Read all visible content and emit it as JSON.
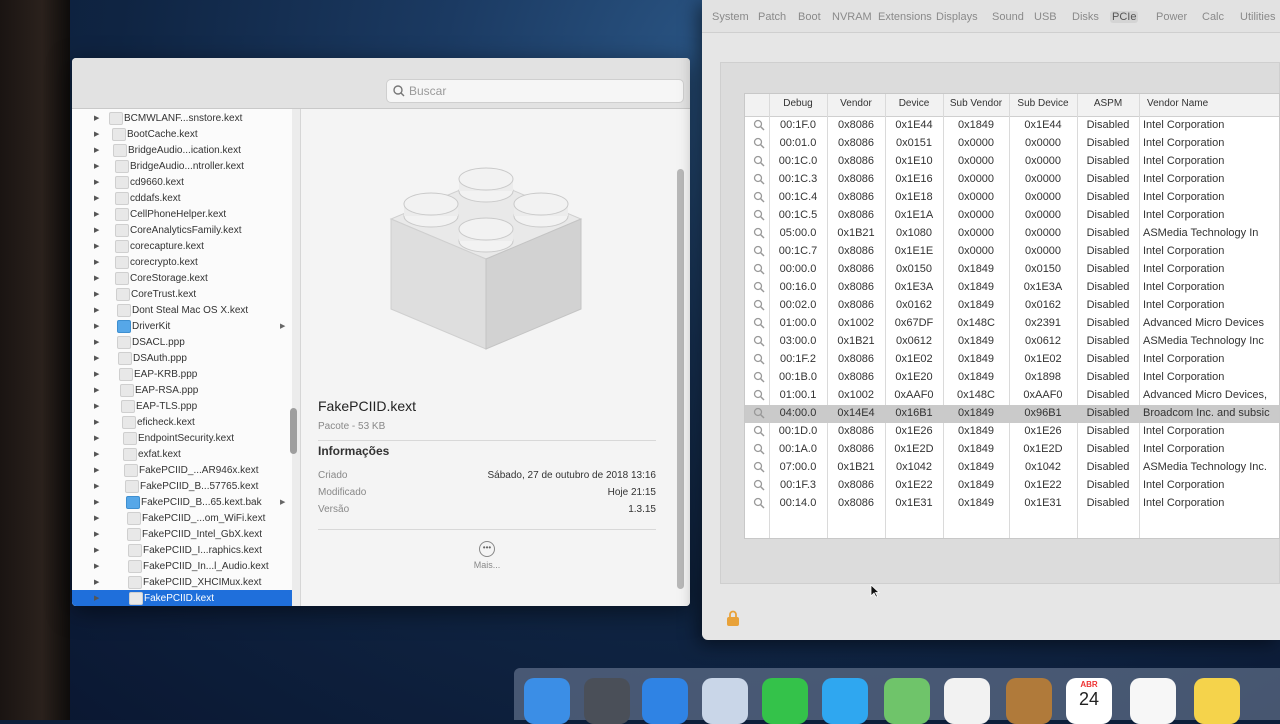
{
  "finder": {
    "search_placeholder": "Buscar",
    "files": [
      {
        "name": "BCMWLANF...snstore.kext"
      },
      {
        "name": "BootCache.kext"
      },
      {
        "name": "BridgeAudio...ication.kext"
      },
      {
        "name": "BridgeAudio...ntroller.kext"
      },
      {
        "name": "cd9660.kext"
      },
      {
        "name": "cddafs.kext"
      },
      {
        "name": "CellPhoneHelper.kext"
      },
      {
        "name": "CoreAnalyticsFamily.kext"
      },
      {
        "name": "corecapture.kext"
      },
      {
        "name": "corecrypto.kext"
      },
      {
        "name": "CoreStorage.kext"
      },
      {
        "name": "CoreTrust.kext"
      },
      {
        "name": "Dont Steal Mac OS X.kext"
      },
      {
        "name": "DriverKit"
      },
      {
        "name": "DSACL.ppp"
      },
      {
        "name": "DSAuth.ppp"
      },
      {
        "name": "EAP-KRB.ppp"
      },
      {
        "name": "EAP-RSA.ppp"
      },
      {
        "name": "EAP-TLS.ppp"
      },
      {
        "name": "eficheck.kext"
      },
      {
        "name": "EndpointSecurity.kext"
      },
      {
        "name": "exfat.kext"
      },
      {
        "name": "FakePCIID_...AR946x.kext"
      },
      {
        "name": "FakePCIID_B...57765.kext"
      },
      {
        "name": "FakePCIID_B...65.kext.bak"
      },
      {
        "name": "FakePCIID_...om_WiFi.kext"
      },
      {
        "name": "FakePCIID_Intel_GbX.kext"
      },
      {
        "name": "FakePCIID_I...raphics.kext"
      },
      {
        "name": "FakePCIID_In...l_Audio.kext"
      },
      {
        "name": "FakePCIID_XHCIMux.kext"
      },
      {
        "name": "FakePCIID.kext"
      }
    ],
    "preview": {
      "title": "FakePCIID.kext",
      "subtitle": "Pacote - 53 KB",
      "info_heading": "Informações",
      "rows": [
        {
          "label": "Criado",
          "value": "Sábado, 27 de outubro de 2018 13:16"
        },
        {
          "label": "Modificado",
          "value": "Hoje 21:15"
        },
        {
          "label": "Versão",
          "value": "1.3.15"
        }
      ],
      "more_label": "Mais..."
    }
  },
  "hackintool": {
    "tabs": [
      "System",
      "Patch",
      "Boot",
      "NVRAM",
      "Extensions",
      "Displays",
      "Sound",
      "USB",
      "Disks",
      "PCIe",
      "Power",
      "Calc",
      "Utilities"
    ],
    "active_tab": "PCIe",
    "columns": [
      "Debug",
      "Vendor",
      "Device",
      "Sub Vendor",
      "Sub Device",
      "ASPM",
      "Vendor Name"
    ],
    "rows": [
      [
        "00:1F.0",
        "0x8086",
        "0x1E44",
        "0x1849",
        "0x1E44",
        "Disabled",
        "Intel Corporation"
      ],
      [
        "00:01.0",
        "0x8086",
        "0x0151",
        "0x0000",
        "0x0000",
        "Disabled",
        "Intel Corporation"
      ],
      [
        "00:1C.0",
        "0x8086",
        "0x1E10",
        "0x0000",
        "0x0000",
        "Disabled",
        "Intel Corporation"
      ],
      [
        "00:1C.3",
        "0x8086",
        "0x1E16",
        "0x0000",
        "0x0000",
        "Disabled",
        "Intel Corporation"
      ],
      [
        "00:1C.4",
        "0x8086",
        "0x1E18",
        "0x0000",
        "0x0000",
        "Disabled",
        "Intel Corporation"
      ],
      [
        "00:1C.5",
        "0x8086",
        "0x1E1A",
        "0x0000",
        "0x0000",
        "Disabled",
        "Intel Corporation"
      ],
      [
        "05:00.0",
        "0x1B21",
        "0x1080",
        "0x0000",
        "0x0000",
        "Disabled",
        "ASMedia Technology In"
      ],
      [
        "00:1C.7",
        "0x8086",
        "0x1E1E",
        "0x0000",
        "0x0000",
        "Disabled",
        "Intel Corporation"
      ],
      [
        "00:00.0",
        "0x8086",
        "0x0150",
        "0x1849",
        "0x0150",
        "Disabled",
        "Intel Corporation"
      ],
      [
        "00:16.0",
        "0x8086",
        "0x1E3A",
        "0x1849",
        "0x1E3A",
        "Disabled",
        "Intel Corporation"
      ],
      [
        "00:02.0",
        "0x8086",
        "0x0162",
        "0x1849",
        "0x0162",
        "Disabled",
        "Intel Corporation"
      ],
      [
        "01:00.0",
        "0x1002",
        "0x67DF",
        "0x148C",
        "0x2391",
        "Disabled",
        "Advanced Micro Devices"
      ],
      [
        "03:00.0",
        "0x1B21",
        "0x0612",
        "0x1849",
        "0x0612",
        "Disabled",
        "ASMedia Technology Inc"
      ],
      [
        "00:1F.2",
        "0x8086",
        "0x1E02",
        "0x1849",
        "0x1E02",
        "Disabled",
        "Intel Corporation"
      ],
      [
        "00:1B.0",
        "0x8086",
        "0x1E20",
        "0x1849",
        "0x1898",
        "Disabled",
        "Intel Corporation"
      ],
      [
        "01:00.1",
        "0x1002",
        "0xAAF0",
        "0x148C",
        "0xAAF0",
        "Disabled",
        "Advanced Micro Devices,"
      ],
      [
        "04:00.0",
        "0x14E4",
        "0x16B1",
        "0x1849",
        "0x96B1",
        "Disabled",
        "Broadcom Inc. and subsic"
      ],
      [
        "00:1D.0",
        "0x8086",
        "0x1E26",
        "0x1849",
        "0x1E26",
        "Disabled",
        "Intel Corporation"
      ],
      [
        "00:1A.0",
        "0x8086",
        "0x1E2D",
        "0x1849",
        "0x1E2D",
        "Disabled",
        "Intel Corporation"
      ],
      [
        "07:00.0",
        "0x1B21",
        "0x1042",
        "0x1849",
        "0x1042",
        "Disabled",
        "ASMedia Technology Inc."
      ],
      [
        "00:1F.3",
        "0x8086",
        "0x1E22",
        "0x1849",
        "0x1E22",
        "Disabled",
        "Intel Corporation"
      ],
      [
        "00:14.0",
        "0x8086",
        "0x1E31",
        "0x1849",
        "0x1E31",
        "Disabled",
        "Intel Corporation"
      ]
    ],
    "selected_row": 16
  },
  "dock": {
    "calendar_month": "ABR",
    "calendar_day": "24",
    "icons": [
      "finder-icon",
      "launchpad-icon",
      "safari-icon",
      "mail-icon",
      "facetime-icon",
      "messages-icon",
      "maps-icon",
      "photos-icon",
      "contacts-icon",
      "calendar-icon",
      "reminders-icon",
      "notes-icon"
    ]
  }
}
